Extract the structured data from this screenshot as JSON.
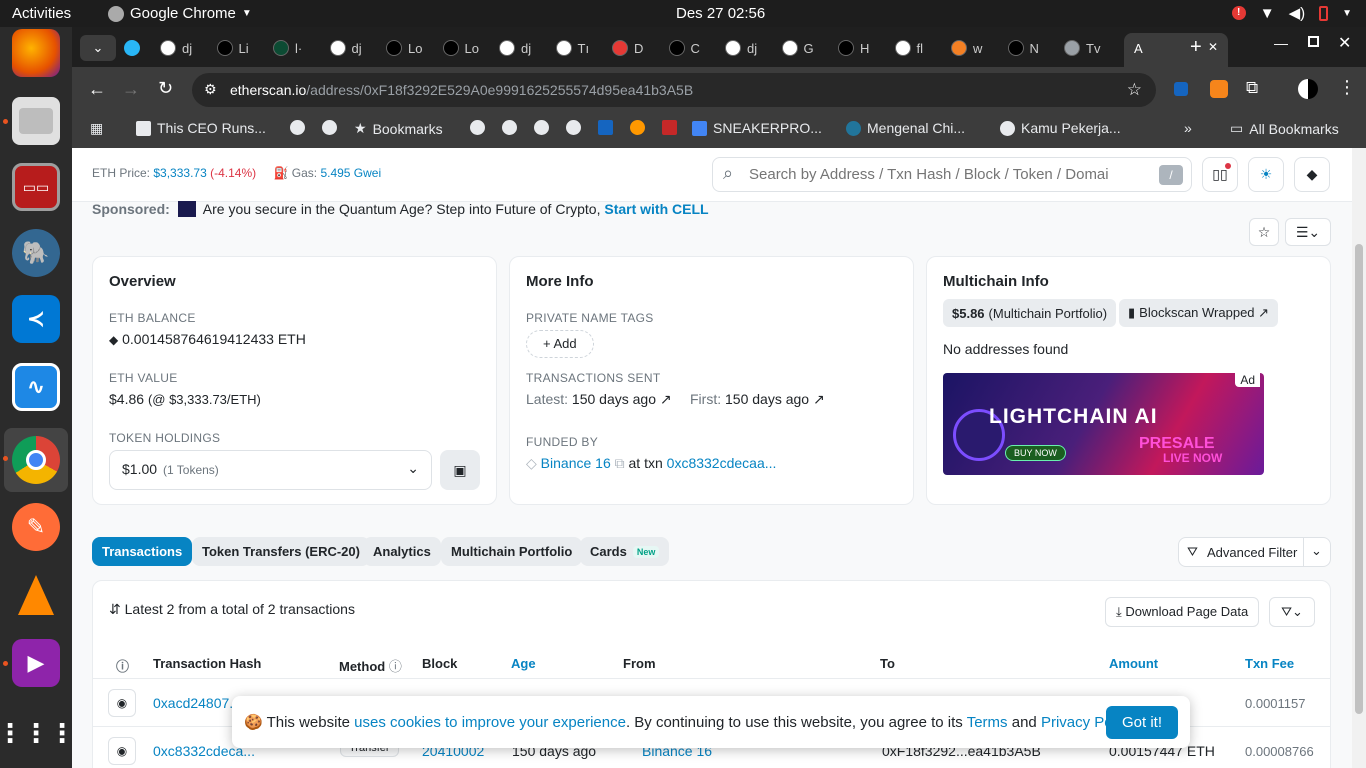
{
  "topbar": {
    "activities": "Activities",
    "app_name": "Google Chrome",
    "clock": "Des 27  02:56"
  },
  "tabs": [
    {
      "label": "dj",
      "icon": "google-icon"
    },
    {
      "label": "Li",
      "icon": "dev-icon"
    },
    {
      "label": "l·",
      "icon": "django-icon"
    },
    {
      "label": "dj",
      "icon": "google-icon"
    },
    {
      "label": "Lo",
      "icon": "dev-icon"
    },
    {
      "label": "Lo",
      "icon": "dev-icon"
    },
    {
      "label": "dj",
      "icon": "google-icon"
    },
    {
      "label": "Tı",
      "icon": "gitea-icon"
    },
    {
      "label": "D",
      "icon": "vercel-icon"
    },
    {
      "label": "C",
      "icon": "medium-icon"
    },
    {
      "label": "dj",
      "icon": "google-icon"
    },
    {
      "label": "G",
      "icon": "github-icon"
    },
    {
      "label": "H",
      "icon": "medium-icon"
    },
    {
      "label": "fl",
      "icon": "google-icon"
    },
    {
      "label": "w",
      "icon": "stackoverflow-icon"
    },
    {
      "label": "N",
      "icon": "x-icon"
    },
    {
      "label": "Tv",
      "icon": "chrome-icon"
    }
  ],
  "active_tab": {
    "label": "A",
    "close": "✕"
  },
  "omnibox": {
    "domain": "etherscan.io",
    "path": "/address/0xF18f3292E529A0e9991625255574d95ea41b3A5B"
  },
  "bookmarks": [
    {
      "label": "This CEO Runs..."
    },
    {
      "label": "Bookmarks"
    },
    {
      "label": "SNEAKERPRO..."
    },
    {
      "label": "Mengenal Chi..."
    },
    {
      "label": "Kamu Pekerja..."
    },
    {
      "label": "All Bookmarks"
    }
  ],
  "header": {
    "eth_price_label": "ETH Price:",
    "eth_price": "$3,333.73",
    "eth_change": "(-4.14%)",
    "gas_label": "Gas:",
    "gas": "5.495 Gwei",
    "search_placeholder": "Search by Address / Txn Hash / Block / Token / Domai",
    "search_key": "/"
  },
  "sponsor": {
    "label": "Sponsored:",
    "text": "Are you secure in the Quantum Age? Step into Future of Crypto,",
    "link": "Start with CELL"
  },
  "overview": {
    "title": "Overview",
    "balance_label": "ETH BALANCE",
    "balance": "0.001458764619412433 ETH",
    "value_label": "ETH VALUE",
    "value": "$4.86",
    "value_sub": "(@ $3,333.73/ETH)",
    "holdings_label": "TOKEN HOLDINGS",
    "holdings": "$1.00",
    "holdings_sub": "(1 Tokens)"
  },
  "more_info": {
    "title": "More Info",
    "tags_label": "PRIVATE NAME TAGS",
    "add": "+ Add",
    "sent_label": "TRANSACTIONS SENT",
    "latest_label": "Latest:",
    "latest": "150 days ago ↗",
    "first_label": "First:",
    "first": "150 days ago ↗",
    "funded_label": "FUNDED BY",
    "funded_by": "Binance 16",
    "at_txn": "at txn",
    "txn": "0xc8332cdecaa..."
  },
  "multichain": {
    "title": "Multichain Info",
    "portfolio_amount": "$5.86",
    "portfolio_label": "(Multichain Portfolio)",
    "blockscan": "Blockscan Wrapped ↗",
    "no_addresses": "No addresses found",
    "ad_tag": "Ad",
    "ad_title": "LIGHTCHAIN AI",
    "ad_presale": "PRESALE",
    "ad_live": "LIVE NOW",
    "ad_buy": "BUY NOW"
  },
  "tabs_page": [
    {
      "label": "Transactions"
    },
    {
      "label": "Token Transfers (ERC-20)"
    },
    {
      "label": "Analytics"
    },
    {
      "label": "Multichain Portfolio"
    },
    {
      "label": "Cards",
      "badge": "New"
    }
  ],
  "advanced_filter": "Advanced Filter",
  "txlist": {
    "summary": "Latest 2 from a total of 2 transactions",
    "download": "Download Page Data",
    "columns": [
      "Transaction Hash",
      "Method",
      "Block",
      "Age",
      "From",
      "To",
      "Amount",
      "Txn Fee"
    ],
    "rows": [
      {
        "hash": "0xacd24807...",
        "method": "",
        "block": "",
        "age": "",
        "from": "",
        "to": "",
        "amount": "",
        "fee": "0.0001157"
      },
      {
        "hash": "0xc8332cdeca...",
        "method": "Transfer",
        "block": "20410002",
        "age": "150 days ago",
        "from": "Binance 16",
        "to": "0xF18f3292...ea41b3A5B",
        "amount": "0.00157447 ETH",
        "fee": "0.00008766"
      }
    ]
  },
  "cookie": {
    "t1": "This website",
    "link1": "uses cookies to improve your experience",
    "t2": ". By continuing to use this website, you agree to its",
    "terms": "Terms",
    "and": "and",
    "privacy": "Privacy Policy",
    "dot": ".",
    "button": "Got it!"
  }
}
